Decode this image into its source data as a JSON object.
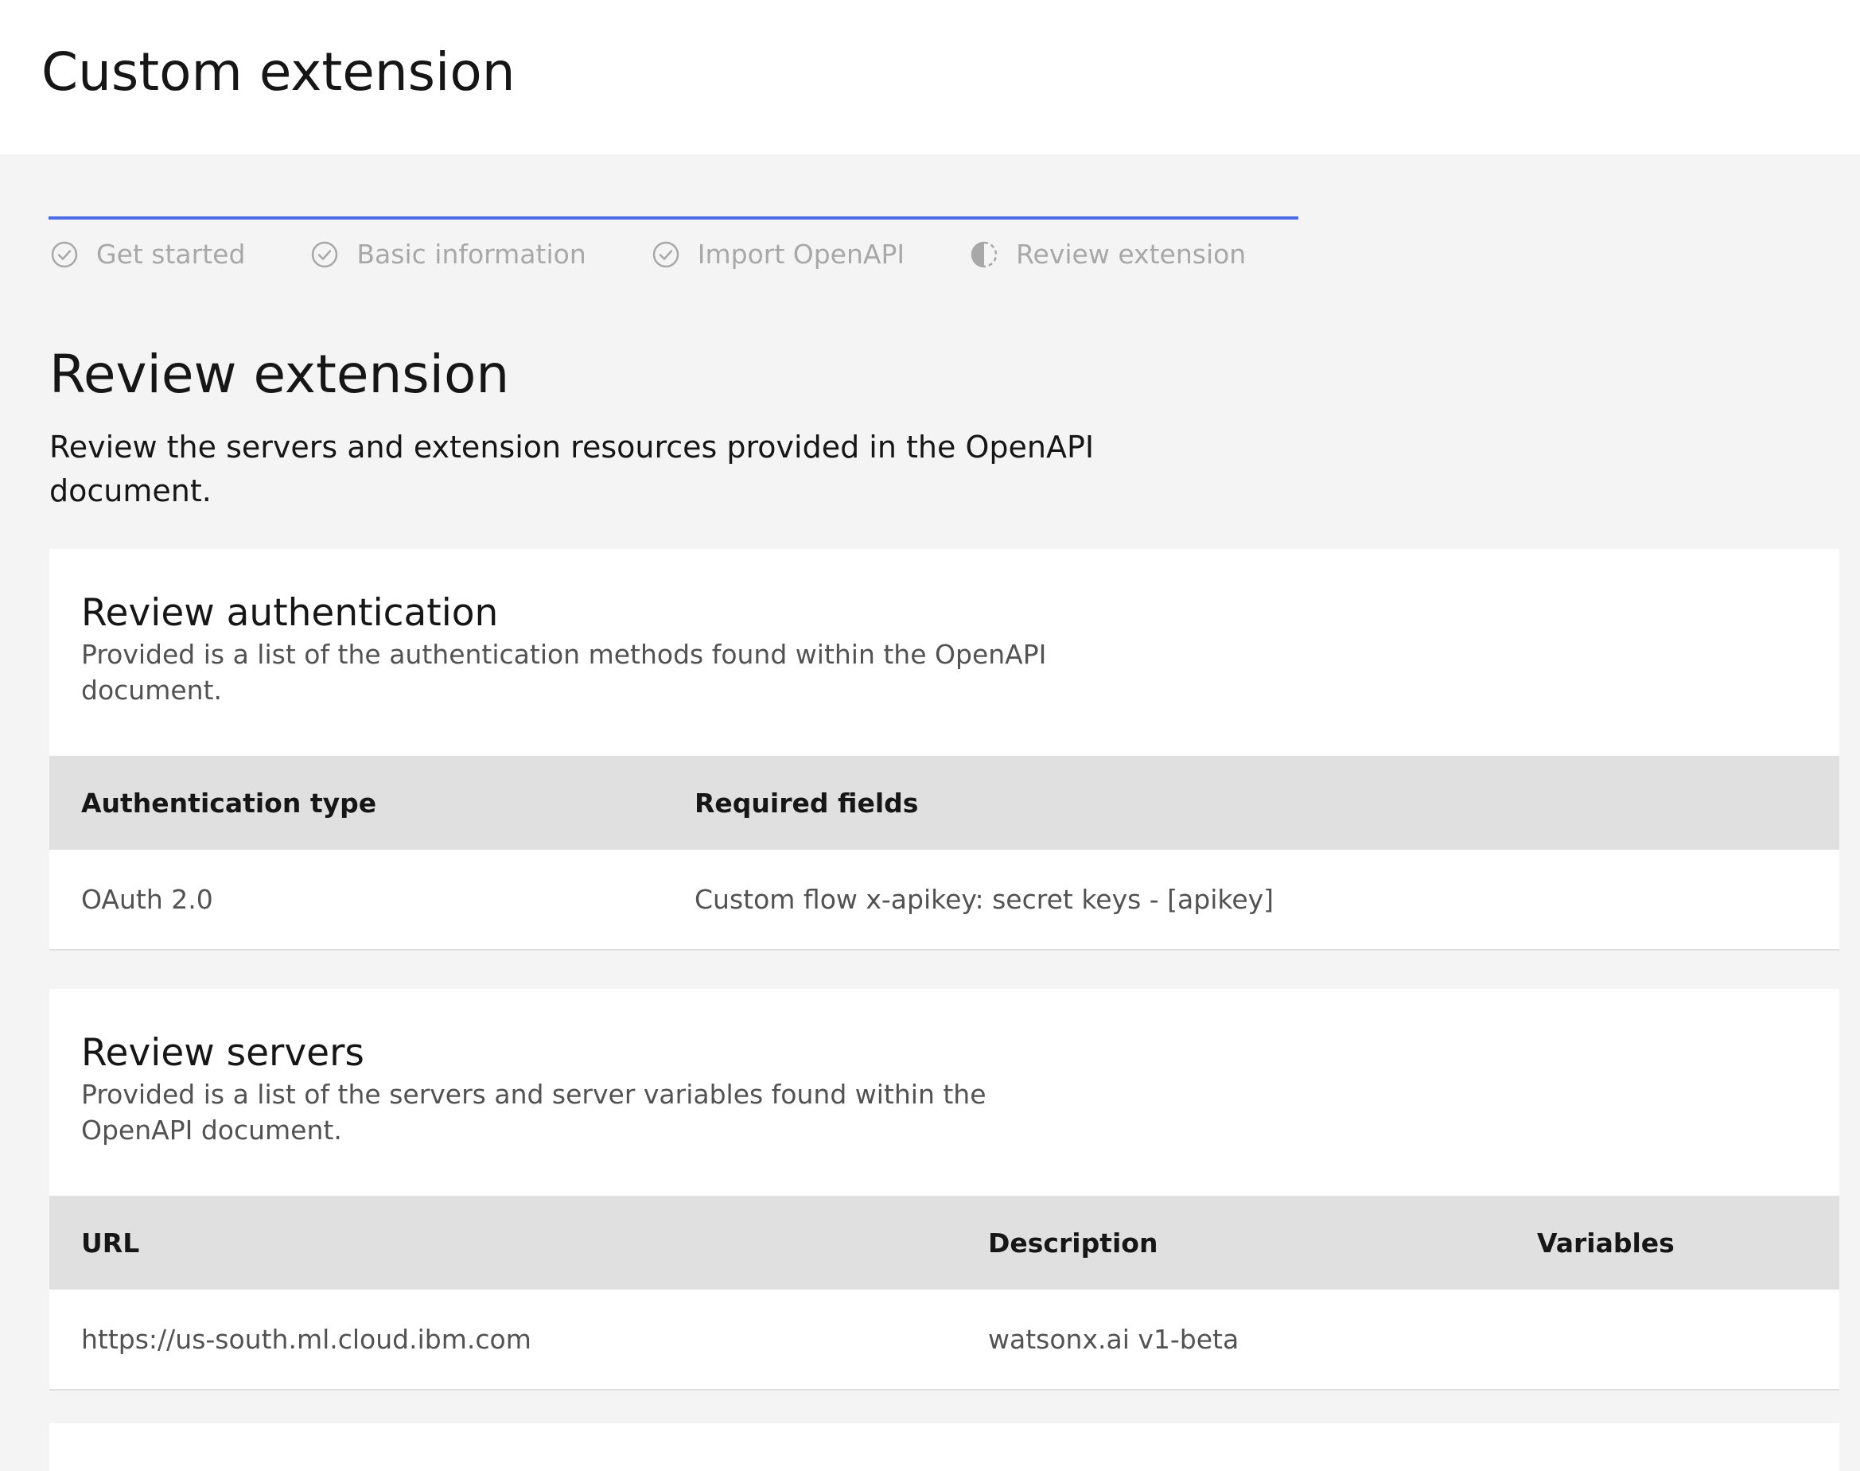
{
  "header": {
    "title": "Custom extension"
  },
  "progress": {
    "steps": [
      {
        "label": "Get started",
        "status": "complete"
      },
      {
        "label": "Basic information",
        "status": "complete"
      },
      {
        "label": "Import OpenAPI",
        "status": "complete"
      },
      {
        "label": "Review extension",
        "status": "current"
      }
    ],
    "accent_color": "#4b6ee8"
  },
  "main": {
    "heading": "Review extension",
    "description": "Review the servers and extension resources provided in the OpenAPI document."
  },
  "authentication": {
    "title": "Review authentication",
    "description": "Provided is a list of the authentication methods found within the OpenAPI document.",
    "columns": [
      "Authentication type",
      "Required fields"
    ],
    "rows": [
      [
        "OAuth 2.0",
        "Custom flow x-apikey: secret keys - [apikey]"
      ]
    ]
  },
  "servers": {
    "title": "Review servers",
    "description": "Provided is a list of the servers and server variables found within the OpenAPI document.",
    "columns": [
      "URL",
      "Description",
      "Variables"
    ],
    "rows": [
      [
        "https://us-south.ml.cloud.ibm.com",
        "watsonx.ai v1-beta",
        ""
      ]
    ]
  },
  "icons": {
    "complete": "checkmark-outline-icon",
    "current": "incomplete-half-circle-icon"
  }
}
